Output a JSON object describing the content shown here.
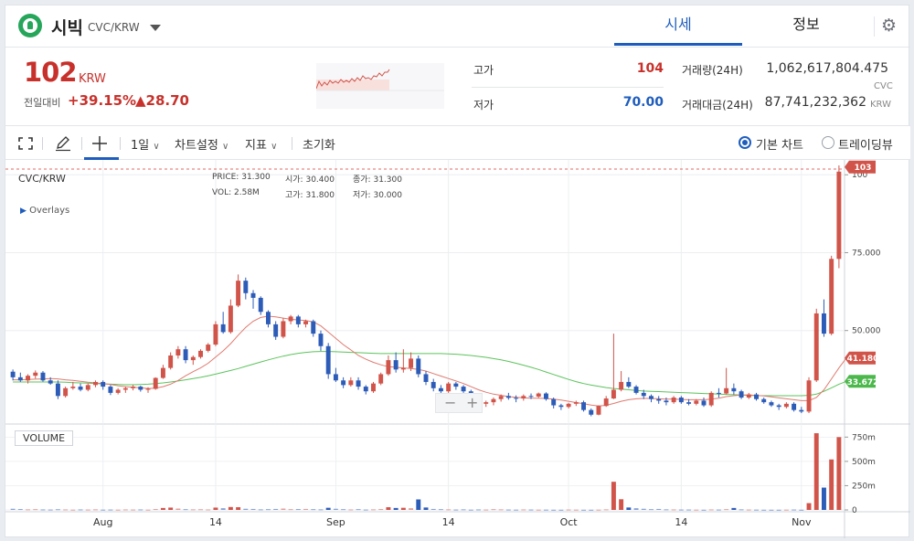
{
  "header": {
    "coin_name": "시빅",
    "coin_pair": "CVC/KRW",
    "tabs": [
      {
        "label": "시세"
      },
      {
        "label": "정보"
      }
    ],
    "settings_icon": "gear-icon"
  },
  "summary": {
    "price": "102",
    "price_unit": "KRW",
    "change_label": "전일대비",
    "change_pct": "+39.15%",
    "change_abs": "▲28.70",
    "high_label": "고가",
    "high_value": "104",
    "low_label": "저가",
    "low_value": "70.00",
    "volume_label": "거래량(24H)",
    "volume_value": "1,062,617,804.475",
    "volume_unit": "CVC",
    "amount_label": "거래대금(24H)",
    "amount_value": "87,741,232,362",
    "amount_unit": "KRW",
    "colors": {
      "up": "#c8312b",
      "down": "#1e5dbd"
    }
  },
  "toolbar": {
    "interval": "1일",
    "chart_settings": "차트설정",
    "indicators": "지표",
    "reset": "초기화",
    "view_basic": "기본 차트",
    "view_trading": "트레이딩뷰"
  },
  "legend": {
    "symbol": "CVC/KRW",
    "overlays": "Overlays",
    "price_label": "PRICE:",
    "price": "31.300",
    "open_label": "시가:",
    "open": "30.400",
    "close_label": "종가:",
    "close": "31.300",
    "vol_label": "VOL:",
    "vol": "2.58M",
    "high_label": "고가:",
    "high": "31.800",
    "low_label": "저가:",
    "low": "30.000",
    "volume_tag": "VOLUME"
  },
  "chart_data": {
    "type": "candlestick",
    "x_ticks": [
      "Aug",
      "14",
      "Sep",
      "14",
      "Oct",
      "14",
      "Nov"
    ],
    "y_ticks": [
      "100",
      "75.000",
      "50.000"
    ],
    "ylim": [
      20,
      103
    ],
    "vol_ticks": [
      "750m",
      "500m",
      "250m",
      "0"
    ],
    "vol_lim": [
      0,
      800
    ],
    "last_price_label": "103",
    "ma_red_label": "41.180",
    "ma_green_label": "33.672",
    "colors": {
      "up": "#d1544a",
      "down": "#2d5cb8",
      "ma_red": "#e07a70",
      "ma_green": "#5cc35c"
    },
    "candles": [
      [
        36.8,
        37.5,
        34,
        35
      ],
      [
        35,
        36.5,
        33.5,
        34
      ],
      [
        34,
        36,
        33,
        35.5
      ],
      [
        35.5,
        37.2,
        34.6,
        36.5
      ],
      [
        36.5,
        37,
        33.6,
        34
      ],
      [
        34,
        35,
        32.6,
        33
      ],
      [
        33,
        34,
        28,
        29
      ],
      [
        29,
        32,
        28.5,
        31.5
      ],
      [
        31.5,
        33.5,
        31,
        32
      ],
      [
        32,
        33,
        30.5,
        31
      ],
      [
        31,
        33,
        30.5,
        32.5
      ],
      [
        32.5,
        34,
        31.8,
        33.5
      ],
      [
        33.5,
        34,
        31,
        32
      ],
      [
        32,
        32.5,
        29.3,
        30
      ],
      [
        30,
        31.5,
        29.5,
        31
      ],
      [
        31,
        32,
        30,
        31.5
      ],
      [
        31.5,
        32.5,
        30.8,
        32
      ],
      [
        32,
        32.3,
        30.4,
        31
      ],
      [
        31,
        31.8,
        30,
        31.3
      ],
      [
        31.3,
        35,
        31,
        34.8
      ],
      [
        34.8,
        39,
        34.5,
        38
      ],
      [
        38,
        43,
        37.5,
        42
      ],
      [
        42,
        45,
        41,
        44
      ],
      [
        44,
        45,
        39.5,
        40.5
      ],
      [
        40.5,
        42,
        39,
        41.5
      ],
      [
        41.5,
        44,
        41,
        43.5
      ],
      [
        43.5,
        46,
        43,
        45.5
      ],
      [
        45.5,
        53,
        45,
        52
      ],
      [
        52,
        56,
        49,
        49.5
      ],
      [
        49.5,
        60,
        49,
        58
      ],
      [
        58,
        68,
        57.5,
        66
      ],
      [
        66,
        67,
        60,
        62
      ],
      [
        62,
        63,
        57,
        60.5
      ],
      [
        60.5,
        61,
        55,
        56
      ],
      [
        56,
        56.5,
        51,
        52
      ],
      [
        52,
        53,
        47,
        48
      ],
      [
        48,
        54,
        47.5,
        53
      ],
      [
        53,
        55,
        52,
        54.5
      ],
      [
        54.5,
        55,
        51,
        52
      ],
      [
        52,
        53.5,
        51,
        53
      ],
      [
        53,
        53.5,
        48,
        49
      ],
      [
        49,
        50,
        43.5,
        45
      ],
      [
        45,
        46,
        34.5,
        36
      ],
      [
        36,
        38,
        33.5,
        34
      ],
      [
        34,
        35,
        31.5,
        32.5
      ],
      [
        32.5,
        35,
        32,
        34
      ],
      [
        34,
        35,
        31,
        32
      ],
      [
        32,
        32.5,
        29.5,
        30.5
      ],
      [
        30.5,
        33.5,
        30,
        33
      ],
      [
        33,
        36.5,
        32.5,
        36
      ],
      [
        36,
        42,
        35.5,
        40.5
      ],
      [
        40.5,
        43,
        36.5,
        37.5
      ],
      [
        37.5,
        44,
        36.5,
        38
      ],
      [
        38,
        43,
        37,
        41
      ],
      [
        41,
        42,
        35,
        36
      ],
      [
        36,
        37,
        32.5,
        33.5
      ],
      [
        33.5,
        34.5,
        30.5,
        31.5
      ],
      [
        31.5,
        32.5,
        29.5,
        30.5
      ],
      [
        30.5,
        33.5,
        30,
        33
      ],
      [
        33,
        33.5,
        31,
        32
      ],
      [
        32,
        32.5,
        30,
        30.5
      ],
      [
        30.5,
        31,
        27,
        28
      ],
      [
        28,
        28.5,
        26.2,
        26.5
      ],
      [
        26.5,
        27.5,
        25.5,
        27
      ],
      [
        27,
        28.5,
        26,
        28
      ],
      [
        28,
        29.5,
        27.2,
        29
      ],
      [
        29,
        30,
        27.8,
        28.4
      ],
      [
        28.4,
        29.2,
        27,
        28.2
      ],
      [
        28.2,
        29.5,
        27.5,
        29
      ],
      [
        29,
        29.8,
        28,
        28.8
      ],
      [
        28.8,
        30.1,
        28.4,
        29.8
      ],
      [
        29.8,
        30.2,
        27.5,
        28
      ],
      [
        28,
        28.5,
        25,
        26
      ],
      [
        26,
        26.5,
        24.5,
        25.5
      ],
      [
        25.5,
        26.8,
        25,
        26.5
      ],
      [
        26.5,
        27.5,
        25.8,
        27
      ],
      [
        27,
        27.5,
        24,
        24.5
      ],
      [
        24.5,
        25,
        22.5,
        23
      ],
      [
        23,
        26,
        22.8,
        25.8
      ],
      [
        25.8,
        29,
        25.5,
        28.2
      ],
      [
        28.2,
        49,
        28,
        31
      ],
      [
        31,
        37,
        30.5,
        33.5
      ],
      [
        33.5,
        35,
        31.5,
        32
      ],
      [
        32,
        32.5,
        29.5,
        30
      ],
      [
        30,
        31,
        28,
        29
      ],
      [
        29,
        29.5,
        27,
        28
      ],
      [
        28,
        29,
        26.5,
        27.5
      ],
      [
        27.5,
        28.5,
        26,
        27
      ],
      [
        27,
        29,
        26.5,
        28.5
      ],
      [
        28.5,
        29,
        26.5,
        27
      ],
      [
        27,
        28,
        26,
        26.5
      ],
      [
        26.5,
        28,
        26,
        27.5
      ],
      [
        27.5,
        28.5,
        25.5,
        26
      ],
      [
        26,
        30.5,
        25.5,
        30
      ],
      [
        30,
        31.5,
        28.5,
        29.8
      ],
      [
        29.8,
        38,
        29.5,
        31.5
      ],
      [
        31.5,
        33,
        29.5,
        30.5
      ],
      [
        30.5,
        31,
        28,
        28.5
      ],
      [
        28.5,
        30,
        28,
        29.5
      ],
      [
        29.5,
        30,
        27.5,
        28
      ],
      [
        28,
        28.5,
        26.5,
        27
      ],
      [
        27,
        27.5,
        25.5,
        26
      ],
      [
        26,
        26.5,
        24.5,
        25.5
      ],
      [
        25.5,
        27,
        25,
        26.5
      ],
      [
        26.5,
        27,
        24,
        24.5
      ],
      [
        24.5,
        25.5,
        23.5,
        24
      ],
      [
        24,
        35,
        23.5,
        34
      ],
      [
        34,
        57,
        33.5,
        55.5
      ],
      [
        55.5,
        60,
        48,
        49
      ],
      [
        49,
        74,
        48.5,
        73
      ],
      [
        73,
        103,
        70,
        101
      ]
    ],
    "volume": [
      12,
      9,
      6,
      8,
      5,
      4,
      7,
      5,
      3,
      5,
      4,
      6,
      3,
      4,
      3,
      5,
      4,
      5,
      3,
      9,
      20,
      24,
      14,
      8,
      6,
      7,
      5,
      24,
      18,
      30,
      28,
      12,
      10,
      6,
      8,
      10,
      14,
      8,
      9,
      10,
      8,
      6,
      22,
      12,
      8,
      5,
      8,
      4,
      6,
      9,
      28,
      20,
      22,
      18,
      108,
      25,
      10,
      8,
      6,
      4,
      6,
      3,
      5,
      4,
      8,
      6,
      4,
      3,
      5,
      4,
      3,
      3,
      2,
      2,
      4,
      3,
      2,
      2,
      3,
      6,
      290,
      110,
      25,
      18,
      12,
      8,
      10,
      6,
      5,
      4,
      4,
      3,
      2,
      5,
      4,
      8,
      20,
      6,
      4,
      3,
      2,
      2,
      2,
      3,
      4,
      2,
      70,
      790,
      230,
      520,
      750
    ],
    "ma_red": [
      34.2,
      34.2,
      34.3,
      34.4,
      34.5,
      34.6,
      34.5,
      34.2,
      34,
      33.7,
      33.4,
      33.2,
      33,
      32.7,
      32.3,
      32,
      31.8,
      31.6,
      31.4,
      31.5,
      32,
      32.8,
      34,
      35.5,
      36.8,
      38,
      39.5,
      41.5,
      43.5,
      45.8,
      48.5,
      51,
      53,
      54.2,
      54.6,
      54.4,
      54,
      53.6,
      53.4,
      53.2,
      52.8,
      51.5,
      49.5,
      47.5,
      45.5,
      43.8,
      42,
      40.8,
      39.8,
      39,
      38.4,
      38.2,
      38,
      37.8,
      37.5,
      37,
      36.2,
      35.4,
      34.6,
      33.8,
      33,
      32,
      31,
      30.2,
      29.6,
      29.2,
      28.8,
      28.6,
      28.4,
      28.3,
      28.3,
      28.2,
      28,
      27.7,
      27.3,
      26.9,
      26.5,
      26.1,
      25.8,
      26,
      26.6,
      27.3,
      27.8,
      28.1,
      28.2,
      28.2,
      28.1,
      28,
      28,
      27.9,
      27.8,
      27.8,
      27.8,
      28,
      28.3,
      28.8,
      29.1,
      29.3,
      29.3,
      29.2,
      29,
      28.7,
      28.4,
      28.1,
      27.8,
      27.5,
      27.5,
      28.5,
      31,
      34.5,
      38,
      41.2
    ],
    "ma_green": [
      33.5,
      33.5,
      33.5,
      33.5,
      33.5,
      33.5,
      33.5,
      33.4,
      33.3,
      33.2,
      33.1,
      33,
      32.9,
      32.8,
      32.7,
      32.6,
      32.6,
      32.7,
      32.8,
      33,
      33.2,
      33.5,
      33.8,
      34.2,
      34.6,
      35,
      35.5,
      36,
      36.6,
      37.2,
      37.8,
      38.5,
      39.2,
      39.9,
      40.6,
      41.2,
      41.8,
      42.3,
      42.7,
      43,
      43.2,
      43.3,
      43.3,
      43.2,
      43.1,
      43,
      42.9,
      42.8,
      42.7,
      42.6,
      42.6,
      42.6,
      42.6,
      42.6,
      42.6,
      42.6,
      42.6,
      42.6,
      42.5,
      42.4,
      42.2,
      42,
      41.7,
      41.4,
      41,
      40.6,
      40.1,
      39.5,
      38.9,
      38.2,
      37.5,
      36.7,
      35.9,
      35.1,
      34.3,
      33.6,
      33,
      32.5,
      32.1,
      31.7,
      31.4,
      31.2,
      31,
      30.8,
      30.6,
      30.5,
      30.4,
      30.3,
      30.2,
      30.1,
      30,
      29.9,
      29.8,
      29.7,
      29.6,
      29.5,
      29.4,
      29.3,
      29.2,
      29.1,
      29.1,
      29.1,
      29.1,
      29.1,
      29.1,
      29.1,
      29.2,
      29.6,
      30.5,
      31.6,
      32.8,
      33.7
    ]
  }
}
